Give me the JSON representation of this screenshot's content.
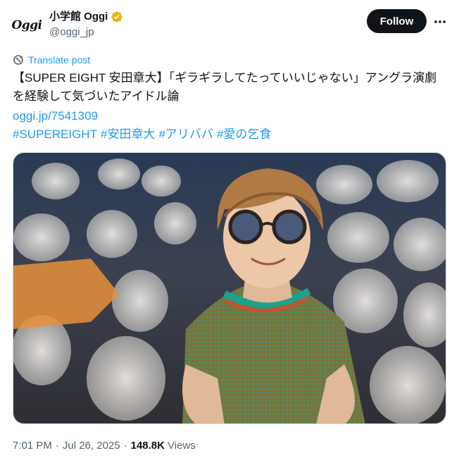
{
  "author": {
    "avatar_text": "Oggi",
    "display_name": "小学館 Oggi",
    "handle": "@oggi_jp"
  },
  "actions": {
    "follow_label": "Follow",
    "more_label": "···"
  },
  "post": {
    "translate_label": "Translate post",
    "text": "【SUPER EIGHT 安田章大】「ギラギラしてたっていいじゃない」アングラ演劇を経験して気づいたアイドル論",
    "link": "oggi.jp/7541309",
    "hashtags": [
      "#SUPEREIGHT",
      "#安田章大",
      "#アリババ",
      "#愛の乞食"
    ]
  },
  "meta": {
    "time": "7:01 PM",
    "date": "Jul 26, 2025",
    "views_count": "148.8K",
    "views_label": "Views"
  },
  "colors": {
    "accent": "#1d9bf0",
    "text": "#0f1419",
    "muted": "#536471",
    "verified_gold": "#e2b719"
  }
}
